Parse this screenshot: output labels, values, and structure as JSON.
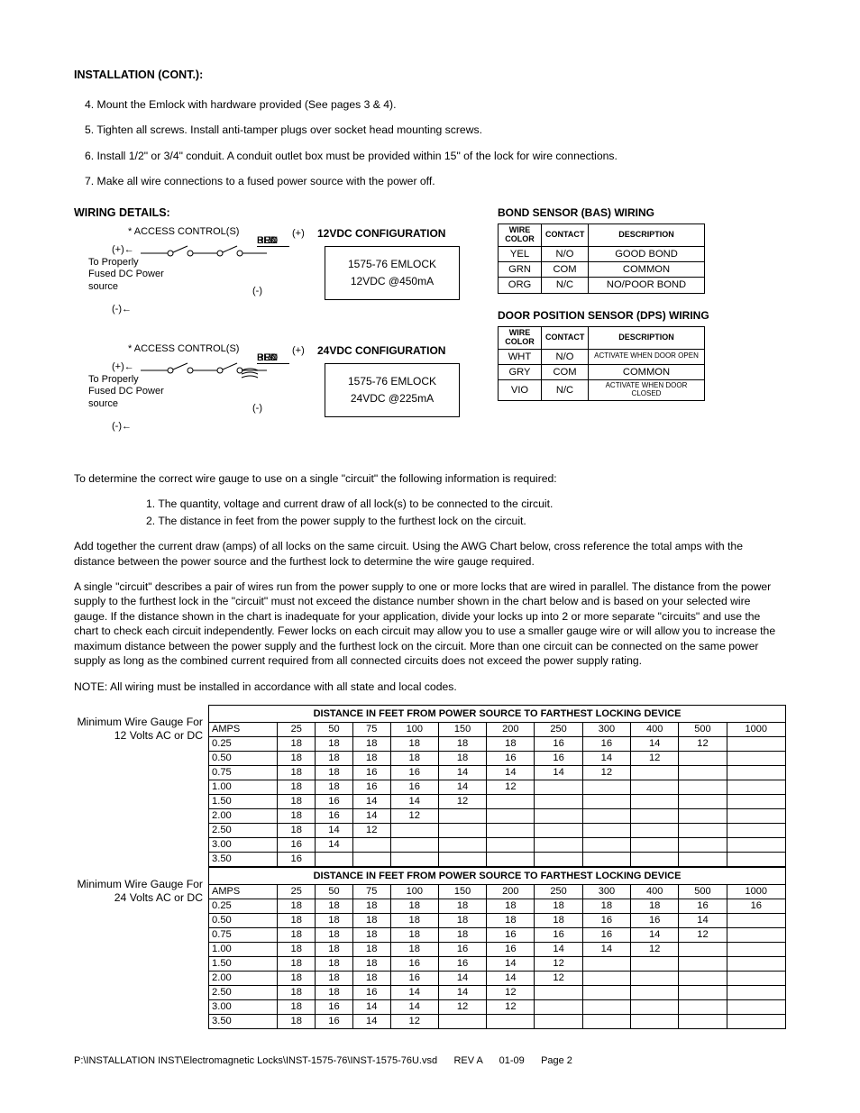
{
  "heading1": "INSTALLATION (CONT.):",
  "steps": [
    "4.  Mount the Emlock with hardware provided (See pages 3 & 4).",
    "5.  Tighten all screws.  Install anti-tamper plugs over socket head mounting screws.",
    "6.  Install 1/2\" or 3/4\" conduit.  A conduit outlet box must be provided within 15\" of the lock for wire connections.",
    "7.  Make all wire connections to a fused power source with the power off."
  ],
  "heading2": "WIRING DETAILS:",
  "diag": {
    "access": "* ACCESS CONTROL(S)",
    "source": "To Properly\nFused DC Power\nsource",
    "wires": [
      "RED",
      "BLU",
      "BLK",
      "BRN"
    ],
    "plus": "(+)",
    "minus": "(-)",
    "c12": {
      "title": "12VDC CONFIGURATION",
      "box": "1575-76 EMLOCK\n12VDC @450mA"
    },
    "c24": {
      "title": "24VDC  CONFIGURATION",
      "box": "1575-76 EMLOCK\n24VDC @225mA"
    }
  },
  "bas": {
    "title": "BOND SENSOR (BAS) WIRING",
    "headers": [
      "WIRE COLOR",
      "CONTACT",
      "DESCRIPTION"
    ],
    "rows": [
      [
        "YEL",
        "N/O",
        "GOOD BOND"
      ],
      [
        "GRN",
        "COM",
        "COMMON"
      ],
      [
        "ORG",
        "N/C",
        "NO/POOR BOND"
      ]
    ]
  },
  "dps": {
    "title": "DOOR POSITION SENSOR (DPS) WIRING",
    "headers": [
      "WIRE COLOR",
      "CONTACT",
      "DESCRIPTION"
    ],
    "rows": [
      [
        "WHT",
        "N/O",
        "ACTIVATE WHEN DOOR OPEN"
      ],
      [
        "GRY",
        "COM",
        "COMMON"
      ],
      [
        "VIO",
        "N/C",
        "ACTIVATE WHEN DOOR CLOSED"
      ]
    ]
  },
  "para1": "To determine the correct wire gauge to use on a single \"circuit\" the following information is required:",
  "req_list": [
    "1.  The quantity, voltage and current draw of all lock(s) to be connected to the circuit.",
    "2.  The distance in feet from the power supply to the furthest lock on the circuit."
  ],
  "para2": "Add together the current draw (amps) of all locks on the same circuit.  Using the AWG Chart below, cross reference the total amps with the distance between the power source and the furthest lock to determine the wire gauge required.",
  "para3": "A single \"circuit\" describes a pair of wires run from the power supply to one or more locks that are wired in parallel.  The distance from the power supply to the furthest lock in the \"circuit\" must not exceed the distance number shown in the chart below and is based on your selected wire gauge.  If the distance shown in the chart is inadequate for your application, divide your locks up into 2 or more separate \"circuits\" and use the chart to check each circuit independently.  Fewer locks on each circuit may allow you to use a smaller gauge wire or will allow you to increase the maximum distance between the power supply and the furthest lock on the circuit.  More than one circuit can be connected on the same power supply as long as the combined current required from all connected circuits does not exceed the power supply rating.",
  "para4": "NOTE:  All wiring must be installed in accordance with all state and local codes.",
  "chart_data": [
    {
      "type": "table",
      "label": "Minimum Wire Gauge For 12 Volts AC or DC",
      "title": "DISTANCE IN FEET FROM POWER SOURCE TO FARTHEST LOCKING DEVICE",
      "columns": [
        "AMPS",
        "25",
        "50",
        "75",
        "100",
        "150",
        "200",
        "250",
        "300",
        "400",
        "500",
        "1000"
      ],
      "rows": [
        [
          "0.25",
          "18",
          "18",
          "18",
          "18",
          "18",
          "18",
          "16",
          "16",
          "14",
          "12",
          ""
        ],
        [
          "0.50",
          "18",
          "18",
          "18",
          "18",
          "18",
          "16",
          "16",
          "14",
          "12",
          "",
          ""
        ],
        [
          "0.75",
          "18",
          "18",
          "16",
          "16",
          "14",
          "14",
          "14",
          "12",
          "",
          "",
          ""
        ],
        [
          "1.00",
          "18",
          "18",
          "16",
          "16",
          "14",
          "12",
          "",
          "",
          "",
          "",
          ""
        ],
        [
          "1.50",
          "18",
          "16",
          "14",
          "14",
          "12",
          "",
          "",
          "",
          "",
          "",
          ""
        ],
        [
          "2.00",
          "18",
          "16",
          "14",
          "12",
          "",
          "",
          "",
          "",
          "",
          "",
          ""
        ],
        [
          "2.50",
          "18",
          "14",
          "12",
          "",
          "",
          "",
          "",
          "",
          "",
          "",
          ""
        ],
        [
          "3.00",
          "16",
          "14",
          "",
          "",
          "",
          "",
          "",
          "",
          "",
          "",
          ""
        ],
        [
          "3.50",
          "16",
          "",
          "",
          "",
          "",
          "",
          "",
          "",
          "",
          "",
          ""
        ]
      ]
    },
    {
      "type": "table",
      "label": "Minimum Wire Gauge For 24 Volts AC or DC",
      "title": "DISTANCE IN FEET FROM POWER SOURCE TO FARTHEST LOCKING DEVICE",
      "columns": [
        "AMPS",
        "25",
        "50",
        "75",
        "100",
        "150",
        "200",
        "250",
        "300",
        "400",
        "500",
        "1000"
      ],
      "rows": [
        [
          "0.25",
          "18",
          "18",
          "18",
          "18",
          "18",
          "18",
          "18",
          "18",
          "18",
          "16",
          "16"
        ],
        [
          "0.50",
          "18",
          "18",
          "18",
          "18",
          "18",
          "18",
          "18",
          "16",
          "16",
          "14",
          ""
        ],
        [
          "0.75",
          "18",
          "18",
          "18",
          "18",
          "18",
          "16",
          "16",
          "16",
          "14",
          "12",
          ""
        ],
        [
          "1.00",
          "18",
          "18",
          "18",
          "18",
          "16",
          "16",
          "14",
          "14",
          "12",
          "",
          ""
        ],
        [
          "1.50",
          "18",
          "18",
          "18",
          "16",
          "16",
          "14",
          "12",
          "",
          "",
          "",
          ""
        ],
        [
          "2.00",
          "18",
          "18",
          "18",
          "16",
          "14",
          "14",
          "12",
          "",
          "",
          "",
          ""
        ],
        [
          "2.50",
          "18",
          "18",
          "16",
          "14",
          "14",
          "12",
          "",
          "",
          "",
          "",
          ""
        ],
        [
          "3.00",
          "18",
          "16",
          "14",
          "14",
          "12",
          "12",
          "",
          "",
          "",
          "",
          ""
        ],
        [
          "3.50",
          "18",
          "16",
          "14",
          "12",
          "",
          "",
          "",
          "",
          "",
          "",
          ""
        ]
      ]
    }
  ],
  "footer": {
    "path": "P:\\INSTALLATION INST\\Electromagnetic Locks\\INST-1575-76\\INST-1575-76U.vsd",
    "rev": "REV A",
    "date": "01-09",
    "page": "Page 2"
  }
}
